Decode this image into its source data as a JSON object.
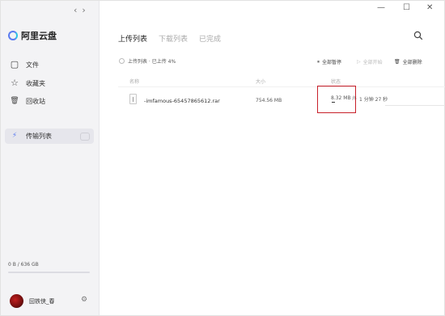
{
  "app": {
    "name": "阿里云盘"
  },
  "nav": {
    "back": "‹",
    "forward": "›"
  },
  "window_controls": {
    "minimize": "—",
    "maximize": "☐",
    "close": "✕"
  },
  "sidebar": {
    "items": [
      {
        "label": "文件",
        "icon": "file-icon",
        "glyph": "▢"
      },
      {
        "label": "收藏夹",
        "icon": "star-icon",
        "glyph": "☆"
      },
      {
        "label": "回收站",
        "icon": "trash-icon",
        "glyph": "🗑"
      },
      {
        "label": "传输列表",
        "icon": "transfer-icon",
        "glyph": "⚡"
      }
    ],
    "storage": {
      "text": "0 B / 636 GB",
      "used_fraction": 0
    },
    "user": {
      "name": "囧铁侠_春",
      "settings_glyph": "⚙"
    }
  },
  "tabs": [
    {
      "label": "上传列表",
      "active": true
    },
    {
      "label": "下载列表",
      "active": false
    },
    {
      "label": "已完成",
      "active": false
    }
  ],
  "subbar": {
    "checkbox_label": "上传列表 · 已上传 4%",
    "pause_all": "全部暂停",
    "start_all": "全部开始",
    "delete_all": "全部删除"
  },
  "columns": {
    "name": "名称",
    "size": "大小",
    "status": "状态"
  },
  "transfer": {
    "file_name": "-imfamous-65457865612.rar",
    "size": "754.56 MB",
    "speed": "8.32 MB /s",
    "remaining": "1 分钟 27 秒"
  },
  "colors": {
    "accent": "#5a7bf0",
    "highlight": "#c8202a",
    "sidebar_bg": "#f3f3f5"
  }
}
